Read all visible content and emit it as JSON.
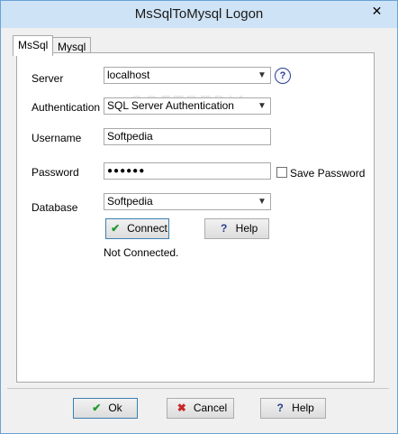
{
  "window": {
    "title": "MsSqlToMysql Logon",
    "close_glyph": "✕"
  },
  "tabs": [
    {
      "label": "MsSql"
    },
    {
      "label": "Mysql"
    }
  ],
  "form": {
    "server": {
      "label": "Server",
      "value": "localhost"
    },
    "authentication": {
      "label": "Authentication",
      "value": "SQL Server Authentication"
    },
    "username": {
      "label": "Username",
      "value": "Softpedia"
    },
    "password": {
      "label": "Password",
      "value": "●●●●●●",
      "save_label": "Save Password",
      "save_checked": false
    },
    "database": {
      "label": "Database",
      "value": "Softpedia"
    },
    "connect_label": "Connect",
    "help_label": "Help",
    "status": "Not Connected."
  },
  "footer": {
    "ok_label": "Ok",
    "cancel_label": "Cancel",
    "help_label": "Help"
  },
  "icons": {
    "connect": "check-icon",
    "help": "question-icon",
    "ok": "check-icon",
    "cancel": "x-icon",
    "server_help": "question-circle-icon"
  },
  "colors": {
    "check": "#1f9a2f",
    "cancel_x": "#c62828",
    "help_q": "#2a3f8a"
  }
}
